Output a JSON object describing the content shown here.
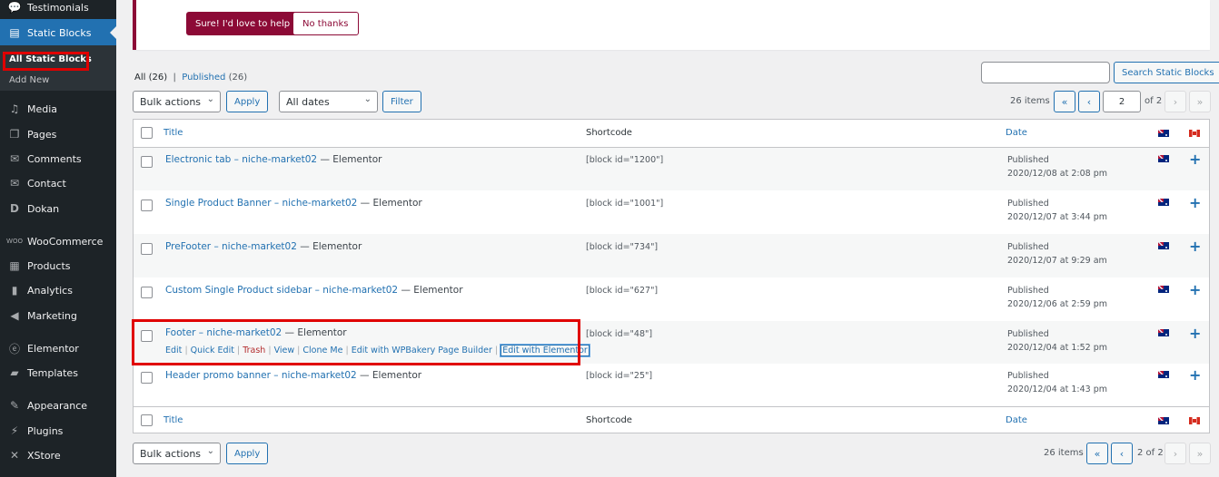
{
  "sidebar": {
    "items": [
      {
        "label": "Testimonials",
        "icon": "speech-bubble-icon"
      },
      {
        "label": "Static Blocks",
        "icon": "layout-icon"
      },
      {
        "label": "Media",
        "icon": "media-icon"
      },
      {
        "label": "Pages",
        "icon": "pages-icon"
      },
      {
        "label": "Comments",
        "icon": "comment-icon"
      },
      {
        "label": "Contact",
        "icon": "mail-icon"
      },
      {
        "label": "Dokan",
        "icon": "dokan-icon"
      },
      {
        "label": "WooCommerce",
        "icon": "woo-icon"
      },
      {
        "label": "Products",
        "icon": "archive-icon"
      },
      {
        "label": "Analytics",
        "icon": "bar-chart-icon"
      },
      {
        "label": "Marketing",
        "icon": "megaphone-icon"
      },
      {
        "label": "Elementor",
        "icon": "elementor-icon"
      },
      {
        "label": "Templates",
        "icon": "folder-icon"
      },
      {
        "label": "Appearance",
        "icon": "paintbrush-icon"
      },
      {
        "label": "Plugins",
        "icon": "plug-icon"
      },
      {
        "label": "XStore",
        "icon": "xstore-icon"
      }
    ],
    "submenu": {
      "all": "All Static Blocks",
      "add_new": "Add New"
    }
  },
  "notice": {
    "primary": "Sure! I'd love to help",
    "secondary": "No thanks"
  },
  "views": {
    "all_label": "All",
    "all_count": "(26)",
    "sep": "|",
    "published_label": "Published",
    "published_count": "(26)"
  },
  "search": {
    "placeholder": "",
    "button": "Search Static Blocks"
  },
  "top_nav": {
    "bulk_actions": "Bulk actions",
    "apply": "Apply",
    "dates": "All dates",
    "filter": "Filter",
    "items": "26 items",
    "first": "«",
    "prev": "‹",
    "next": "›",
    "last": "»",
    "page": "2",
    "of": "of 2"
  },
  "bottom_nav": {
    "bulk_actions": "Bulk actions",
    "apply": "Apply",
    "items": "26 items",
    "first": "«",
    "prev": "‹",
    "next": "›",
    "last": "»",
    "page_text": "2 of 2"
  },
  "columns": {
    "title": "Title",
    "shortcode": "Shortcode",
    "date": "Date"
  },
  "rows": [
    {
      "title": "Electronic tab – niche-market02",
      "suffix": " — Elementor",
      "shortcode": "[block id=\"1200\"]",
      "status": "Published",
      "date": "2020/12/08 at 2:08 pm"
    },
    {
      "title": "Single Product Banner – niche-market02",
      "suffix": " — Elementor",
      "shortcode": "[block id=\"1001\"]",
      "status": "Published",
      "date": "2020/12/07 at 3:44 pm"
    },
    {
      "title": "PreFooter – niche-market02",
      "suffix": " — Elementor",
      "shortcode": "[block id=\"734\"]",
      "status": "Published",
      "date": "2020/12/07 at 9:29 am"
    },
    {
      "title": "Custom Single Product sidebar – niche-market02",
      "suffix": " — Elementor",
      "shortcode": "[block id=\"627\"]",
      "status": "Published",
      "date": "2020/12/06 at 2:59 pm"
    },
    {
      "title": "Footer – niche-market02",
      "suffix": " — Elementor",
      "shortcode": "[block id=\"48\"]",
      "status": "Published",
      "date": "2020/12/04 at 1:52 pm"
    },
    {
      "title": "Header promo banner – niche-market02",
      "suffix": " — Elementor",
      "shortcode": "[block id=\"25\"]",
      "status": "Published",
      "date": "2020/12/04 at 1:43 pm"
    }
  ],
  "row_actions": {
    "edit": "Edit",
    "quick_edit": "Quick Edit",
    "trash": "Trash",
    "view": "View",
    "clone": "Clone Me",
    "wpbakery": "Edit with WPBakery Page Builder",
    "elementor": "Edit with Elementor",
    "sep": "|"
  },
  "colors": {
    "accent": "#2271b1",
    "notice_brand": "#8c0a36",
    "highlight": "#e00000",
    "sidebar_bg": "#1d2327"
  }
}
